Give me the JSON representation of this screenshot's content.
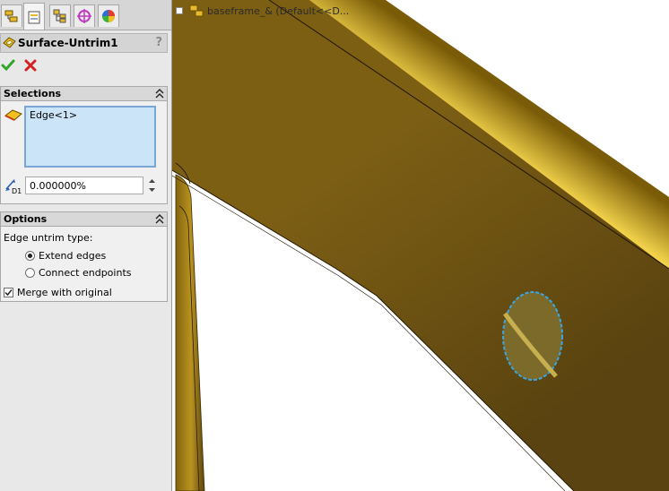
{
  "property_manager": {
    "title": "Surface-Untrim1",
    "help": "?",
    "tabs": [
      "feature-manager-icon",
      "property-manager-icon",
      "configuration-manager-icon",
      "dimxpert-icon",
      "display-manager-icon"
    ]
  },
  "selections": {
    "title": "Selections",
    "items": [
      "Edge<1>"
    ],
    "distance_value": "0.000000%",
    "distance_icon_label": "D1"
  },
  "options": {
    "title": "Options",
    "edge_untrim_label": "Edge untrim type:",
    "radio_extend": "Extend edges",
    "radio_connect": "Connect endpoints",
    "selected_radio": "extend",
    "merge_label": "Merge with original",
    "merge_checked": true
  },
  "tree": {
    "root_label": "baseframe_&  (Default<<D..."
  },
  "colors": {
    "ok": "#2fa52f",
    "cancel": "#d42020",
    "selection_bg": "#cce4f7",
    "part_gold": "#c89a1a"
  }
}
